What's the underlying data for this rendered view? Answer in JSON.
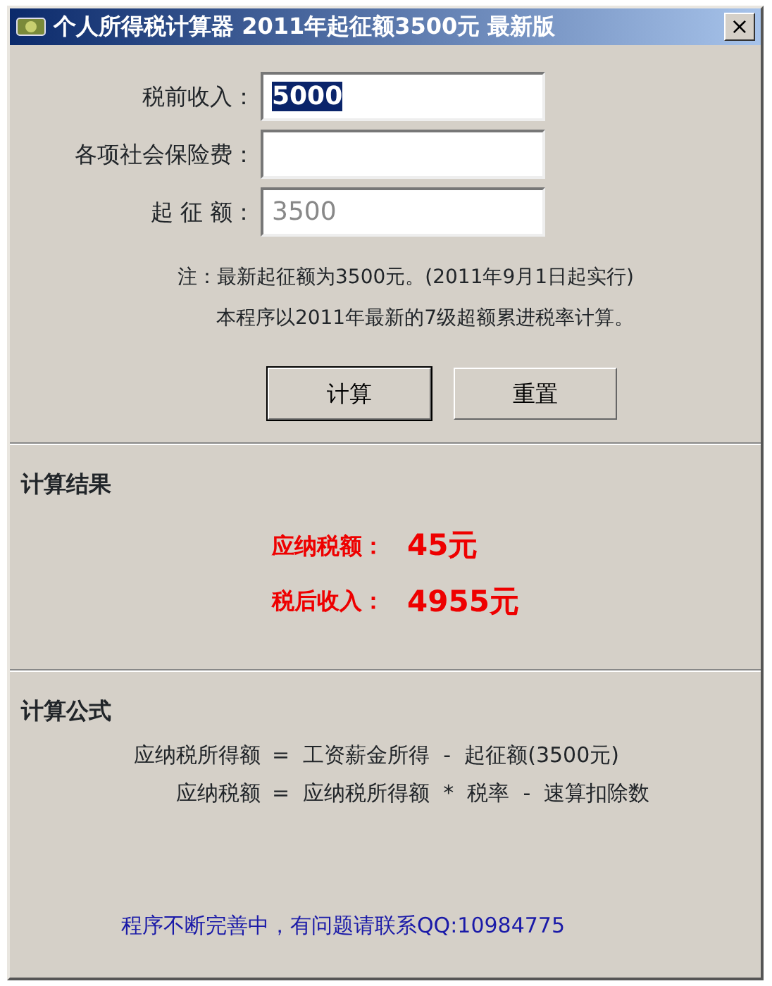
{
  "window": {
    "title": "个人所得税计算器  2011年起征额3500元  最新版",
    "close": "×"
  },
  "fields": [
    {
      "label": "税前收入：",
      "value": "5000",
      "highlighted": true,
      "disabled": false
    },
    {
      "label": "各项社会保险费："
    },
    {
      "label": "起 征 额：",
      "value": "3500",
      "highlighted": false,
      "disabled": true
    }
  ],
  "notes": [
    "注：最新起征额为3500元。(2011年9月1日起实行)",
    "本程序以2011年最新的7级超额累进税率计算。"
  ],
  "buttons": [
    {
      "label": "计算",
      "default": true
    },
    {
      "label": "重置",
      "default": false
    }
  ],
  "results": {
    "heading": "计算结果",
    "rows": [
      {
        "label": "应纳税额：",
        "value": "45元"
      },
      {
        "label": "税后收入：",
        "value": "4955元"
      }
    ]
  },
  "formula": {
    "heading": "计算公式",
    "lines": [
      {
        "left": "应纳税所得额",
        "rest": "=  工资薪金所得  -  起征额(3500元)"
      },
      {
        "left": "应纳税额",
        "rest": "=  应纳税所得额  *  税率  -  速算扣除数"
      }
    ]
  },
  "footer": "程序不断完善中，有问题请联系QQ:10984775"
}
